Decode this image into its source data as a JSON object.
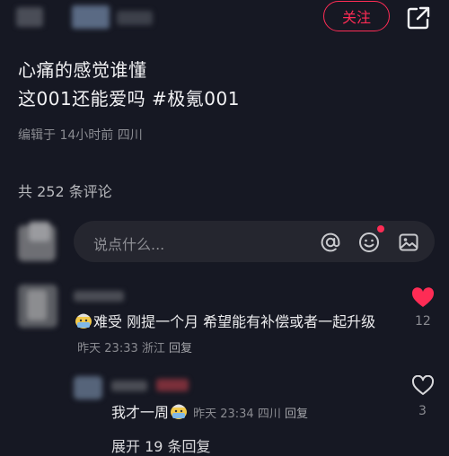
{
  "header": {
    "follow_label": "关注"
  },
  "post": {
    "line1": "心痛的感觉谁懂",
    "line2_text": "这001还能爱吗 ",
    "hashtag": "#极氪001",
    "meta": "编辑于 14小时前 四川"
  },
  "comments_header": {
    "count_text": "共 252 条评论"
  },
  "composer": {
    "placeholder": "说点什么..."
  },
  "comment": {
    "text": "难受 刚提一个月  希望能有补偿或者一起升级",
    "emoji_icon": "crying-face-icon",
    "time": "昨天 23:33",
    "location": "浙江",
    "reply_label": "回复",
    "likes": "12",
    "liked": true,
    "like_color": "#fe2c55"
  },
  "reply": {
    "text": "我才一周",
    "emoji_icon": "crying-face-icon",
    "time": "昨天 23:34",
    "location": "四川",
    "reply_label": "回复",
    "likes": "3",
    "liked": false
  },
  "expand_label": "展开 19 条回复",
  "colors": {
    "background": "#161823",
    "accent": "#fe2c55",
    "muted_text": "#8a8b91"
  }
}
